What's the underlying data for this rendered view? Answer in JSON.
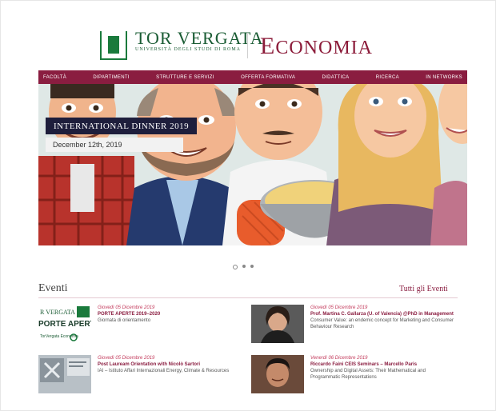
{
  "header": {
    "tv_title": "TOR VERGATA",
    "tv_subtitle": "UNIVERSITÀ DEGLI STUDI DI ROMA",
    "economia_initial": "E",
    "economia_rest": "CONOMIA"
  },
  "nav": {
    "items": [
      "Facoltà",
      "Dipartimenti",
      "Strutture e Servizi",
      "Offerta Formativa",
      "Didattica",
      "Ricerca",
      "In Networks"
    ]
  },
  "hero": {
    "title": "INTERNATIONAL DINNER 2019",
    "date": "December 12th, 2019",
    "slides": 3,
    "active_slide": 0
  },
  "events": {
    "title": "Eventi",
    "all_link": "Tutti gli Eventi",
    "items": [
      {
        "date": "Giovedì 05 Dicembre 2019",
        "title": "PORTE APERTE 2019–2020",
        "desc": "Giornata di orientamento",
        "thumb_top": "R VERGATA",
        "thumb_mid": "PORTE APERTE",
        "thumb_bottom": "TorVergata Economia"
      },
      {
        "date": "Giovedì 05 Dicembre 2019",
        "title": "Prof. Martina C. Gallarza (U. of Valencia) @PhD in Management",
        "desc": "Consumer Value: an endemic concept for Marketing and Consumer Behaviour Research"
      },
      {
        "date": "Giovedì 05 Dicembre 2019",
        "title": "Post Lauream Orientation with Nicolò Sartori",
        "desc": "IAI – Istituto Affari Internazionali Energy, Climate & Resources"
      },
      {
        "date": "Venerdì 06 Dicembre 2019",
        "title": "Riccardo Faini CEIS Seminars – Marcello Paris",
        "desc": "Ownership and Digital Assets: Their Mathematical and Programmatic Representations"
      }
    ]
  },
  "colors": {
    "brand_maroon": "#8a1d40",
    "brand_green": "#1a7a3c",
    "caption_navy": "#1e1e3c"
  }
}
